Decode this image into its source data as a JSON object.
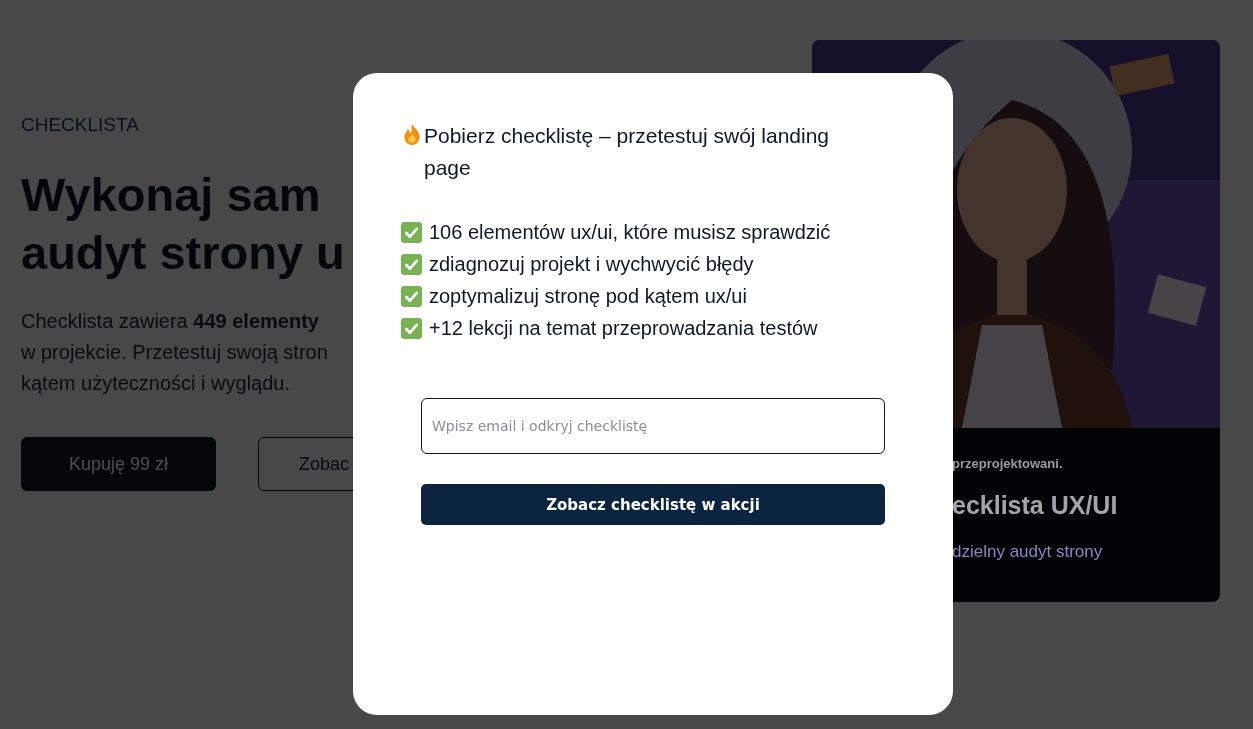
{
  "page": {
    "eyebrow": "CHECKLISTA",
    "headline_lines": [
      "Wykonaj sam",
      "audyt strony u"
    ],
    "description_lines": [
      "Checklista zawiera **449 elementy**",
      "w projekcie. Przetestuj swoją stron",
      "kątem użyteczności i wyglądu."
    ],
    "buttons": [
      {
        "label": "Kupuję 99 zł",
        "kind": "primary"
      },
      {
        "label": "Zobac",
        "kind": "outline"
      }
    ],
    "product_card": {
      "tagline": "przeprojektowani.",
      "title": "ecklista UX/UI",
      "subtitle": "dzielny audyt strony"
    }
  },
  "modal": {
    "heading": "Pobierz checklistę – przetestuj swój landing page",
    "benefits": [
      "106 elementów ux/ui, które musisz sprawdzić",
      "zdiagnozuj projekt i wychwycić błędy",
      "zoptymalizuj stronę pod kątem ux/ui",
      "+12 lekcji na temat przeprowadzania testów"
    ],
    "email_field": {
      "placeholder": "Wpisz email i odkryj checklistę"
    },
    "submit_button": "Zobacz checklistę w akcji"
  }
}
